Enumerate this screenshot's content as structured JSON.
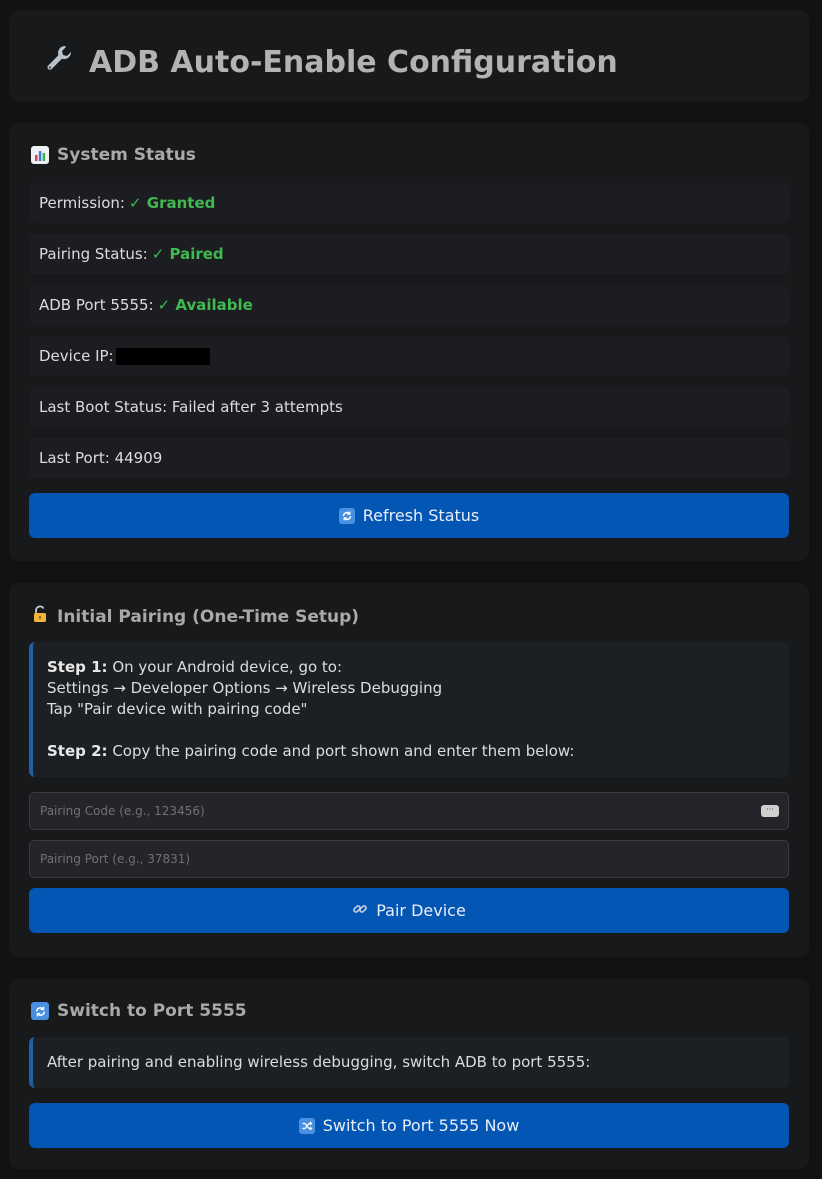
{
  "header": {
    "icon": "wrench-icon",
    "title": "ADB Auto-Enable Configuration"
  },
  "status": {
    "icon": "bar-chart-icon",
    "title": "System Status",
    "rows": [
      {
        "label": "Permission:",
        "value": "✓ Granted"
      },
      {
        "label": "Pairing Status:",
        "value": "✓ Paired"
      },
      {
        "label": "ADB Port 5555:",
        "value": "✓ Available"
      },
      {
        "label": "Device IP:",
        "value": ""
      },
      {
        "label": "Last Boot Status: Failed after 3 attempts",
        "value": ""
      },
      {
        "label": "Last Port: 44909",
        "value": ""
      }
    ],
    "refresh_label": "Refresh Status",
    "refresh_icon": "refresh-icon",
    "ok_color": "#3fb950"
  },
  "pairing": {
    "icon": "lock-icon",
    "title": "Initial Pairing (One-Time Setup)",
    "step1_label": "Step 1:",
    "step1_text": " On your Android device, go to:",
    "step1_line2": "Settings → Developer Options → Wireless Debugging",
    "step1_line3": "Tap \"Pair device with pairing code\"",
    "step2_label": "Step 2:",
    "step2_text": " Copy the pairing code and port shown and enter them below:",
    "code_placeholder": "Pairing Code (e.g., 123456)",
    "port_placeholder": "Pairing Port (e.g., 37831)",
    "pair_label": "Pair Device",
    "pair_icon": "link-icon"
  },
  "switch": {
    "icon": "refresh-icon",
    "title": "Switch to Port 5555",
    "info": "After pairing and enabling wireless debugging, switch ADB to port 5555:",
    "button_label": "Switch to Port 5555 Now",
    "button_icon": "shuffle-icon"
  },
  "colors": {
    "accent": "#0456b4",
    "background": "#111214",
    "card": "#18191b"
  }
}
